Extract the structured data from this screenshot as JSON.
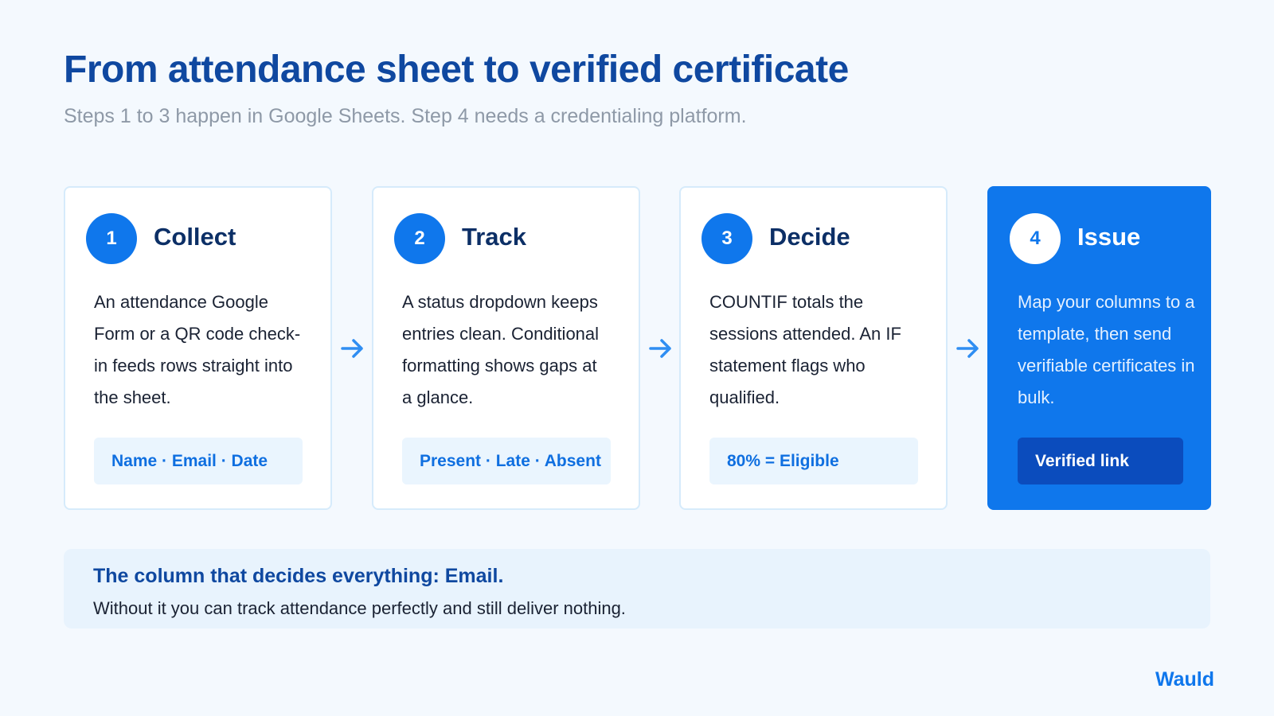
{
  "header": {
    "title": "From attendance sheet to verified certificate",
    "subtitle": "Steps 1 to 3 happen in Google Sheets. Step 4 needs a credentialing platform."
  },
  "steps": [
    {
      "number": "1",
      "title": "Collect",
      "description": "An attendance Google Form or a QR code check-in feeds rows straight into the sheet.",
      "tag": "Name · Email · Date"
    },
    {
      "number": "2",
      "title": "Track",
      "description": "A status dropdown keeps entries clean. Conditional formatting shows gaps at a glance.",
      "tag": "Present · Late · Absent"
    },
    {
      "number": "3",
      "title": "Decide",
      "description": "COUNTIF totals the sessions attended. An IF statement flags who qualified.",
      "tag": "80% = Eligible"
    },
    {
      "number": "4",
      "title": "Issue",
      "description": "Map your columns to a template, then send verifiable certificates in bulk.",
      "tag": "Verified link"
    }
  ],
  "note": {
    "title": "The column that decides everything: Email.",
    "text": "Without it you can track attendance perfectly and still deliver nothing."
  },
  "brand": "Wauld",
  "colors": {
    "accent": "#0f77ec",
    "title": "#0f48a0",
    "background": "#f4f9fe"
  },
  "icons": {
    "connector": "arrow-right-icon"
  }
}
